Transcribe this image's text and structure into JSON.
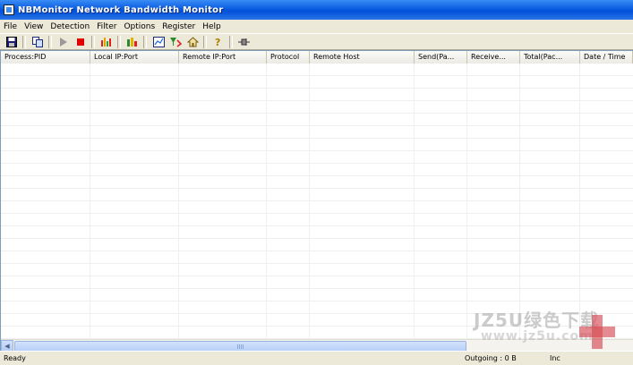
{
  "window": {
    "title": "NBMonitor Network Bandwidth Monitor",
    "icon": "app-monitor-icon"
  },
  "menu": [
    {
      "label": "File"
    },
    {
      "label": "View"
    },
    {
      "label": "Detection"
    },
    {
      "label": "Filter"
    },
    {
      "label": "Options"
    },
    {
      "label": "Register"
    },
    {
      "label": "Help"
    }
  ],
  "toolbar": {
    "buttons": [
      {
        "icon": "save-icon",
        "glyph": "💾"
      },
      {
        "icon": "copy-icon",
        "glyph": "⧉"
      },
      {
        "icon": "play-icon",
        "glyph": "▶"
      },
      {
        "icon": "stop-icon",
        "glyph": "■"
      },
      {
        "icon": "bandwidth-chart-icon",
        "glyph": "▥"
      },
      {
        "icon": "bar-chart-icon",
        "glyph": "▮"
      },
      {
        "icon": "graph-window-icon",
        "glyph": "▣"
      },
      {
        "icon": "filter-refresh-icon",
        "glyph": "↯"
      },
      {
        "icon": "home-icon",
        "glyph": "⌂"
      },
      {
        "icon": "help-icon",
        "glyph": "?"
      },
      {
        "icon": "pin-icon",
        "glyph": "⊸"
      }
    ]
  },
  "table": {
    "columns": [
      {
        "label": "Process:PID"
      },
      {
        "label": "Local IP:Port"
      },
      {
        "label": "Remote IP:Port"
      },
      {
        "label": "Protocol"
      },
      {
        "label": "Remote Host"
      },
      {
        "label": "Send(Pa..."
      },
      {
        "label": "Receive..."
      },
      {
        "label": "Total(Pac..."
      },
      {
        "label": "Date / Time"
      }
    ]
  },
  "scrollbar": {
    "left_arrow": "◀"
  },
  "status": {
    "ready": "Ready",
    "outgoing": "Outgoing : 0 B",
    "incoming": "Inc"
  },
  "watermark": {
    "line1": "JZ5U绿色下载",
    "line2": "www.jz5u.com"
  },
  "colors": {
    "titlebar": "#0a5de0",
    "window_bg": "#ece9d8",
    "stop_red": "#e00000",
    "play_gray": "#9a9a9a"
  }
}
